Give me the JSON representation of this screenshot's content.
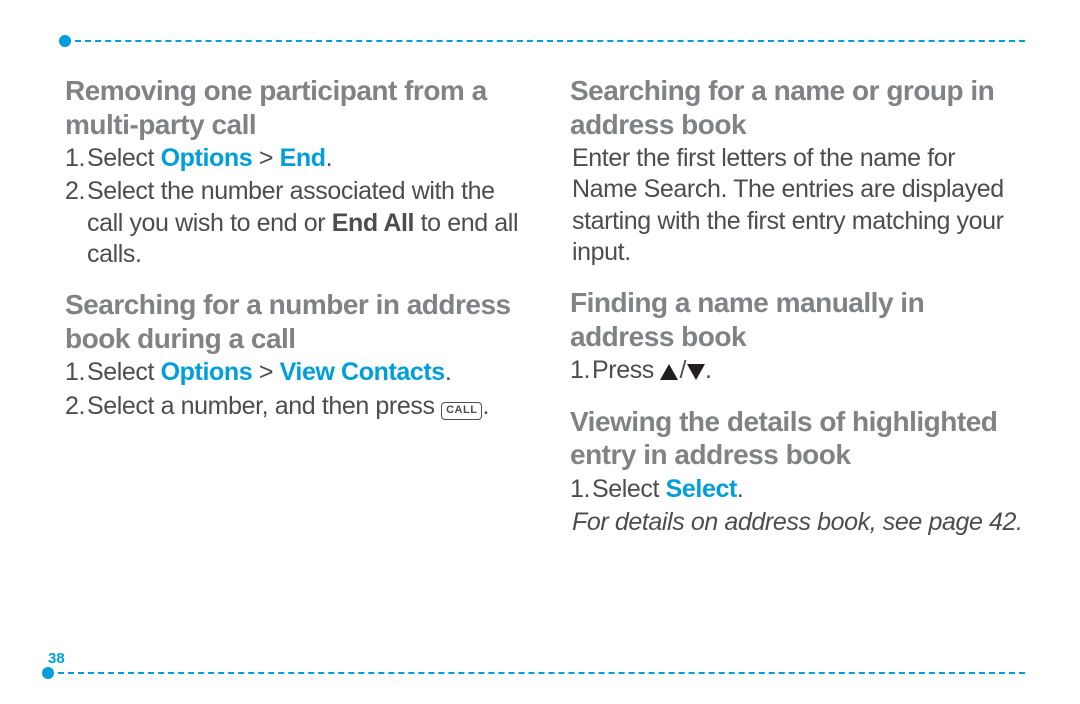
{
  "page_number": "38",
  "left": {
    "section1": {
      "heading": "Removing one participant from a multi-party call",
      "step1_prefix": "Select ",
      "step1_link1": "Options",
      "step1_sep": " > ",
      "step1_link2": "End",
      "step1_suffix": ".",
      "step2_prefix": "Select the number associated with the call you wish to end or ",
      "step2_bold": "End All",
      "step2_suffix": " to end all calls."
    },
    "section2": {
      "heading": "Searching for a number in address book during a call",
      "step1_prefix": "Select ",
      "step1_link1": "Options",
      "step1_sep": " > ",
      "step1_link2": "View Contacts",
      "step1_suffix": ".",
      "step2_prefix": "Select a number, and then press ",
      "step2_btn": "CALL",
      "step2_suffix": "."
    }
  },
  "right": {
    "section1": {
      "heading": "Searching for a name or group in address book",
      "body": "Enter the first letters of the name for Name Search. The entries are displayed starting with the first entry matching your input."
    },
    "section2": {
      "heading": "Finding a name manually in address book",
      "step1_prefix": "Press ",
      "step1_suffix": "."
    },
    "section3": {
      "heading": "Viewing the details of highlighted entry in address book",
      "step1_prefix": "Select ",
      "step1_link": "Select",
      "step1_suffix": ".",
      "note": "For details on address book, see page 42."
    }
  }
}
